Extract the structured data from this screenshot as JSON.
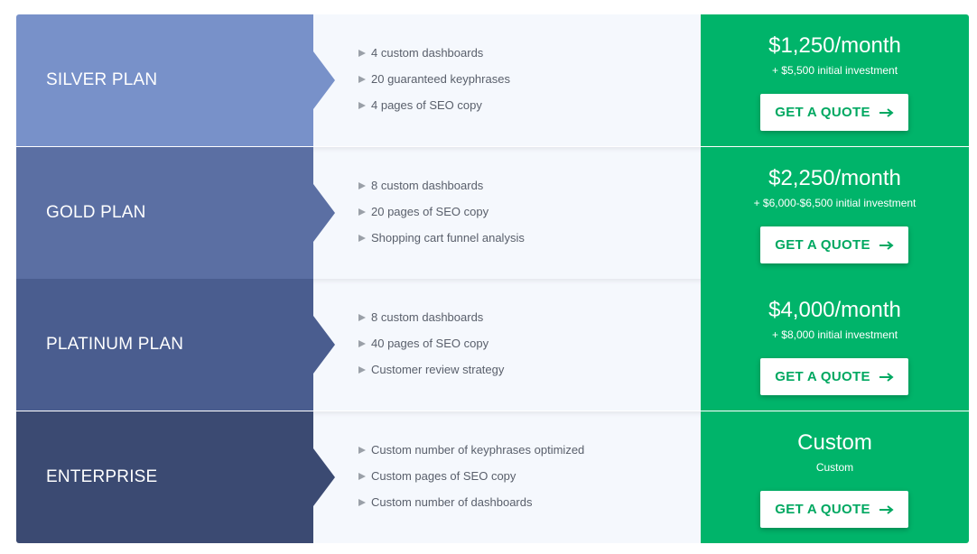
{
  "plans": [
    {
      "name": "SILVER PLAN",
      "features": [
        "4 custom dashboards",
        "20 guaranteed keyphrases",
        "4 pages of SEO copy"
      ],
      "price": "$1,250/month",
      "investment": "+ $5,500 initial investment",
      "button_label": "GET A QUOTE"
    },
    {
      "name": "GOLD PLAN",
      "features": [
        "8 custom dashboards",
        "20 pages of SEO copy",
        "Shopping cart funnel analysis"
      ],
      "price": "$2,250/month",
      "investment": "+ $6,000-$6,500 initial investment",
      "button_label": "GET A QUOTE"
    },
    {
      "name": "PLATINUM PLAN",
      "features": [
        "8 custom dashboards",
        "40 pages of SEO copy",
        "Customer review strategy"
      ],
      "price": "$4,000/month",
      "investment": "+ $8,000 initial investment",
      "button_label": "GET A QUOTE"
    },
    {
      "name": "ENTERPRISE",
      "features": [
        "Custom number of keyphrases optimized",
        "Custom pages of SEO copy",
        "Custom number of dashboards"
      ],
      "price": "Custom",
      "investment": "Custom",
      "button_label": "GET A QUOTE"
    }
  ],
  "icons": {
    "feature_bullet": "triangle-right-icon",
    "button_arrow": "arrow-right-icon"
  },
  "colors": {
    "silver": "#7891c9",
    "gold": "#5b6fa3",
    "platinum": "#4a5d8f",
    "enterprise": "#3b4a72",
    "price_bg": "#00b46a",
    "button_text": "#00a861",
    "features_bg": "#f5f8fd"
  }
}
